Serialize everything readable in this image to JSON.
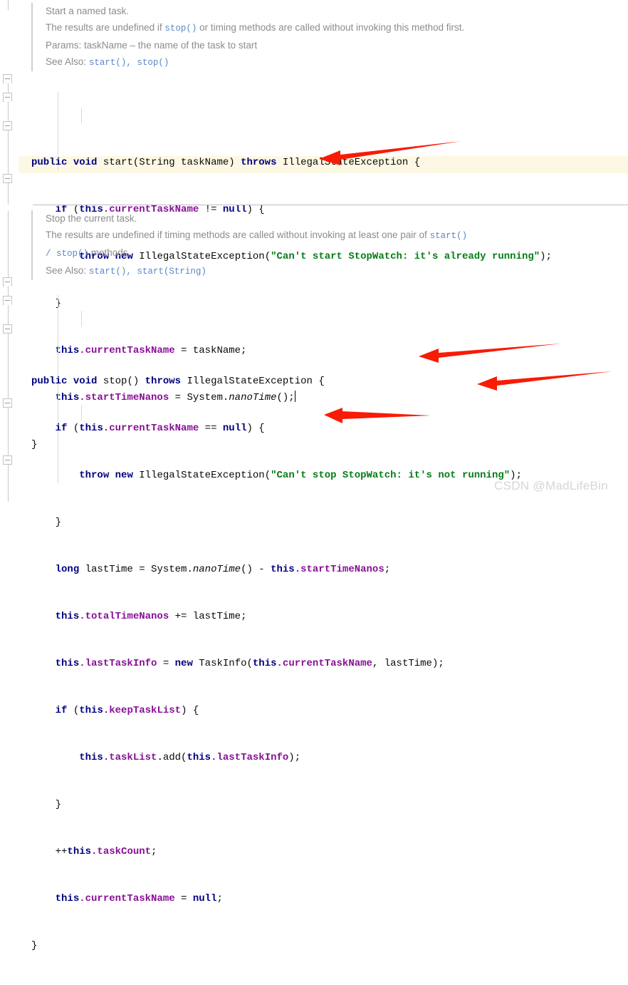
{
  "watermark": "CSDN @MadLifeBin",
  "blocks": [
    {
      "id": "start-method",
      "doc": {
        "summary": "Start a named task.",
        "description_pre": "The results are undefined if ",
        "description_link": "stop()",
        "description_post": " or timing methods are called without invoking this method first.",
        "params_label": "Params:",
        "params_value": "taskName – the name of the task to start",
        "see_also_label": "See Also:",
        "see_also_links": [
          "start()",
          ", ",
          "stop()"
        ]
      },
      "code_lines": [
        "public void start(String taskName) throws IllegalStateException {",
        "    if (this.currentTaskName != null) {",
        "        throw new IllegalStateException(\"Can't start StopWatch: it's already running\");",
        "    }",
        "    this.currentTaskName = taskName;",
        "    this.startTimeNanos = System.nanoTime();",
        "}"
      ],
      "highlighted_line_index": 5
    },
    {
      "id": "stop-method",
      "doc": {
        "summary": "Stop the current task.",
        "description_pre": "The results are undefined if timing methods are called without invoking at least one pair of ",
        "description_link": "start()",
        "description_post": "",
        "description_line2_link": "/ stop()",
        "description_line2_post": " methods.",
        "see_also_label": "See Also:",
        "see_also_links": [
          "start()",
          ", ",
          "start(String)"
        ]
      },
      "code_lines": [
        "public void stop() throws IllegalStateException {",
        "    if (this.currentTaskName == null) {",
        "        throw new IllegalStateException(\"Can't stop StopWatch: it's not running\");",
        "    }",
        "    long lastTime = System.nanoTime() - this.startTimeNanos;",
        "    this.totalTimeNanos += lastTime;",
        "    this.lastTaskInfo = new TaskInfo(this.currentTaskName, lastTime);",
        "    if (this.keepTaskList) {",
        "        this.taskList.add(this.lastTaskInfo);",
        "    }",
        "    ++this.taskCount;",
        "    this.currentTaskName = null;",
        "}"
      ],
      "highlighted_line_index": -1
    }
  ],
  "annotations": [
    {
      "name": "arrow-start-time-nanos",
      "target": "this.startTimeNanos = System.nanoTime();",
      "color": "#f81b05"
    },
    {
      "name": "arrow-last-time",
      "target": "long lastTime = System.nanoTime() - this.startTimeNanos;",
      "color": "#f81b05"
    },
    {
      "name": "arrow-last-task-info",
      "target": "this.lastTaskInfo = new TaskInfo(this.currentTaskName, lastTime);",
      "color": "#f81b05"
    },
    {
      "name": "arrow-task-list-add",
      "target": "this.taskList.add(this.lastTaskInfo);",
      "color": "#f81b05"
    }
  ],
  "colors": {
    "keyword": "#000080",
    "field": "#871094",
    "string": "#067d17",
    "doc_text": "#8c8c8c",
    "doc_link": "#5a87c9",
    "highlight_row": "#fdf8e3",
    "arrow": "#f81b05",
    "watermark": "#d6d6d6"
  }
}
